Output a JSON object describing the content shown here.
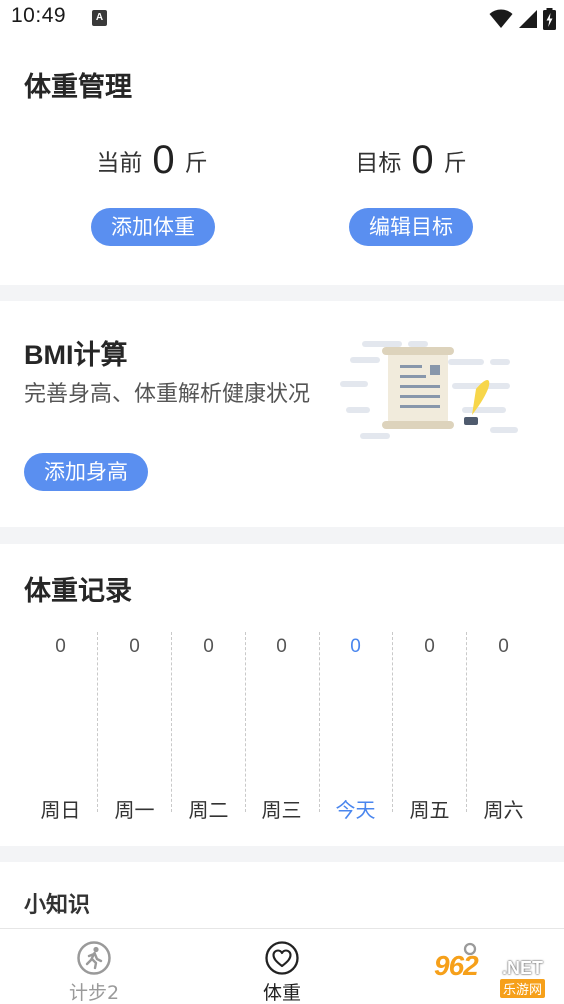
{
  "status_bar": {
    "time": "10:49",
    "notification_letter": "A"
  },
  "weight_card": {
    "title": "体重管理",
    "current": {
      "label": "当前",
      "value": "0",
      "unit": "斤"
    },
    "target": {
      "label": "目标",
      "value": "0",
      "unit": "斤"
    },
    "add_weight_label": "添加体重",
    "edit_target_label": "编辑目标"
  },
  "bmi_card": {
    "title": "BMI计算",
    "description": "完善身高、体重解析健康状况",
    "add_height_label": "添加身高"
  },
  "record_card": {
    "title": "体重记录",
    "days": [
      {
        "value": "0",
        "label": "周日"
      },
      {
        "value": "0",
        "label": "周一"
      },
      {
        "value": "0",
        "label": "周二"
      },
      {
        "value": "0",
        "label": "周三"
      },
      {
        "value": "0",
        "label": "今天"
      },
      {
        "value": "0",
        "label": "周五"
      },
      {
        "value": "0",
        "label": "周六"
      }
    ],
    "today_color": "#4a86ee"
  },
  "tips_card": {
    "title": "小知识"
  },
  "tab_bar": {
    "tabs": [
      {
        "label": "计步2",
        "icon": "walking-person-icon",
        "active": false
      },
      {
        "label": "体重",
        "icon": "heart-icon",
        "active": true
      },
      {
        "label": "",
        "icon": "profile-icon",
        "active": false
      }
    ]
  },
  "watermark": {
    "number": "962",
    "suffix": ".NET",
    "chinese": "乐游网"
  },
  "colors": {
    "accent": "#5a8ff0",
    "background": "#f3f4f6",
    "card": "#ffffff"
  }
}
